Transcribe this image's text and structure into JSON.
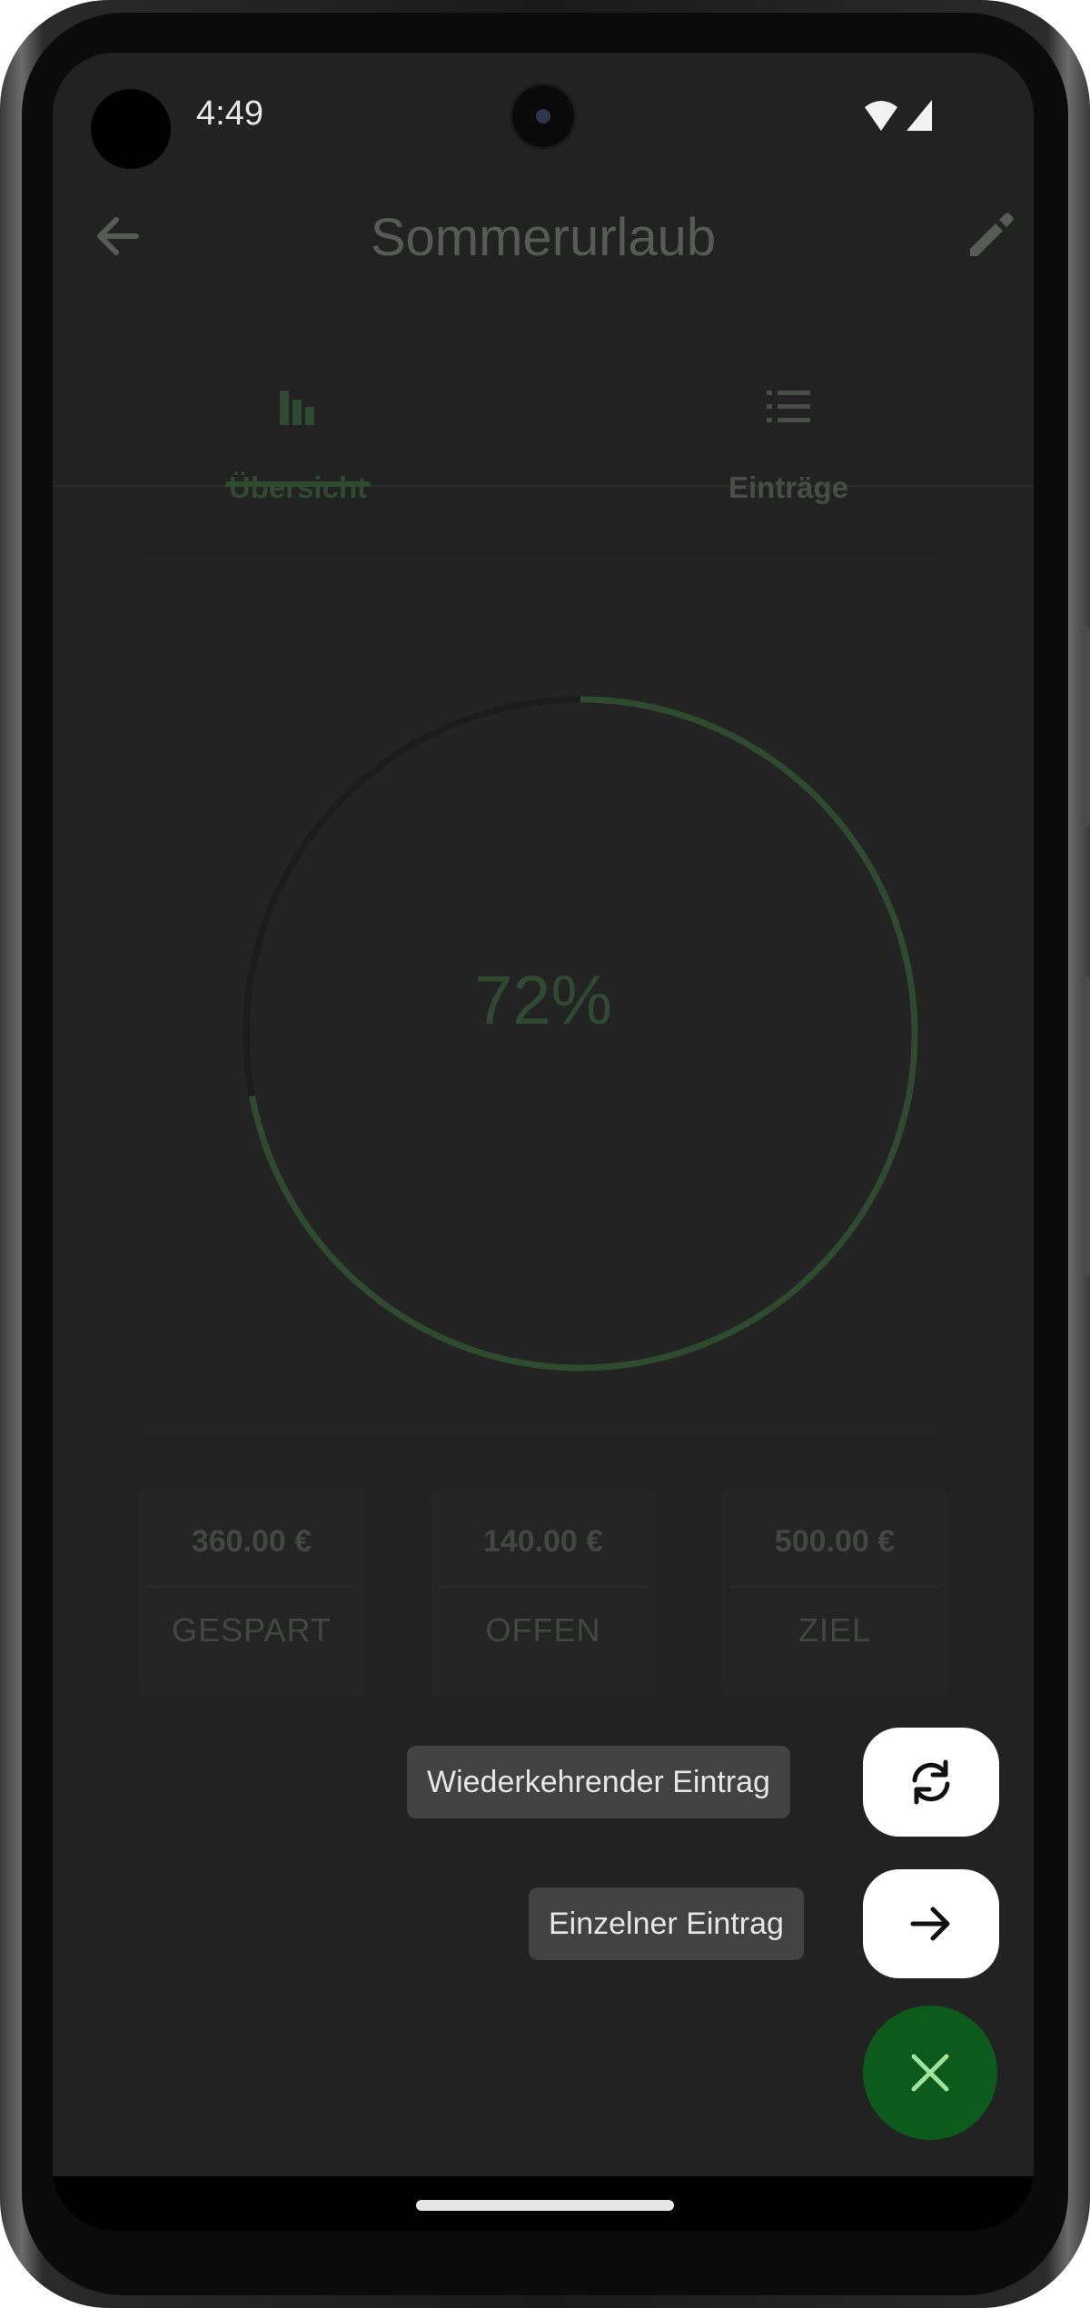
{
  "status_bar": {
    "time": "4:49",
    "icons": [
      "wifi-icon",
      "cellular-signal-icon"
    ]
  },
  "app_bar": {
    "title": "Sommerurlaub",
    "back_icon": "arrow-back-icon",
    "edit_icon": "pencil-edit-icon"
  },
  "tabs": [
    {
      "label": "Übersicht",
      "icon": "bar-chart-icon",
      "selected": true
    },
    {
      "label": "Einträge",
      "icon": "list-icon",
      "selected": false
    }
  ],
  "progress": {
    "percent_label": "72%",
    "fraction": 0.72
  },
  "stats": [
    {
      "value": "360.00 €",
      "label": "GESPART"
    },
    {
      "value": "140.00 €",
      "label": "OFFEN"
    },
    {
      "value": "500.00 €",
      "label": "ZIEL"
    }
  ],
  "fab_menu": {
    "items": [
      {
        "label": "Wiederkehrender Eintrag",
        "icon": "sync-icon"
      },
      {
        "label": "Einzelner Eintrag",
        "icon": "arrow-forward-icon"
      }
    ],
    "close_icon": "close-icon"
  },
  "colors": {
    "accent": "#0c5a1c",
    "progress_ring": "#2e4a2f",
    "background": "#212221"
  }
}
